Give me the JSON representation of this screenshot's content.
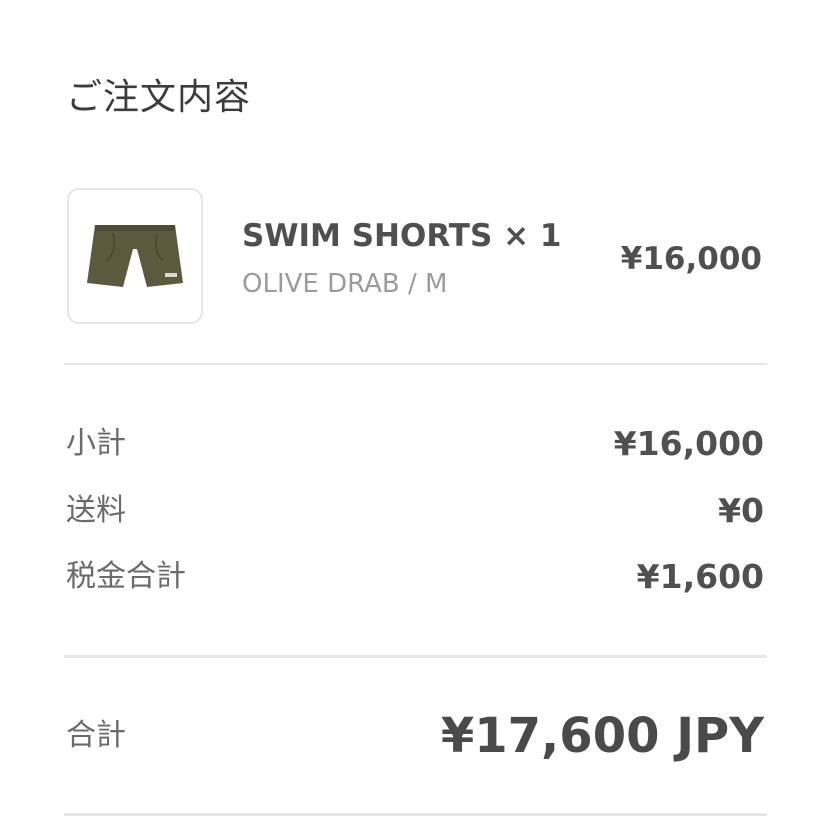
{
  "order": {
    "title": "ご注文内容",
    "item": {
      "image_icon": "swim-shorts-thumbnail",
      "name": "SWIM SHORTS × 1",
      "variant": "OLIVE DRAB / M",
      "price": "¥16,000",
      "product_color": "#5b5a3e"
    },
    "summary": {
      "subtotal_label": "小計",
      "subtotal_value": "¥16,000",
      "shipping_label": "送料",
      "shipping_value": "¥0",
      "tax_label": "税金合計",
      "tax_value": "¥1,600"
    },
    "total": {
      "label": "合計",
      "value": "¥17,600 JPY"
    }
  }
}
